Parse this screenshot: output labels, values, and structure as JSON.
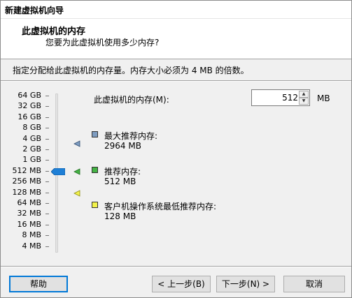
{
  "window": {
    "title": "新建虚拟机向导"
  },
  "header": {
    "title": "此虚拟机的内存",
    "subtitle": "您要为此虚拟机使用多少内存?"
  },
  "instruction": "指定分配给此虚拟机的内存量。内存大小必须为 4 MB 的倍数。",
  "scale": {
    "labels": [
      "64 GB",
      "32 GB",
      "16 GB",
      "8 GB",
      "4 GB",
      "2 GB",
      "1 GB",
      "512 MB",
      "256 MB",
      "128 MB",
      "64 MB",
      "32 MB",
      "16 MB",
      "8 MB",
      "4 MB"
    ],
    "selected": "512 MB"
  },
  "memory": {
    "label": "此虚拟机的内存(M):",
    "value": "512",
    "unit": "MB"
  },
  "legend": {
    "max": {
      "label": "最大推荐内存:",
      "value": "2964 MB",
      "color": "#7e9cc0"
    },
    "recommended": {
      "label": "推荐内存:",
      "value": "512 MB",
      "color": "#44b344"
    },
    "min": {
      "label": "客户机操作系统最低推荐内存:",
      "value": "128 MB",
      "color": "#f2f24a"
    }
  },
  "buttons": {
    "help": "帮助",
    "back": "< 上一步(B)",
    "next": "下一步(N) >",
    "cancel": "取消"
  },
  "colors": {
    "thumb": "#1e7fd6"
  }
}
